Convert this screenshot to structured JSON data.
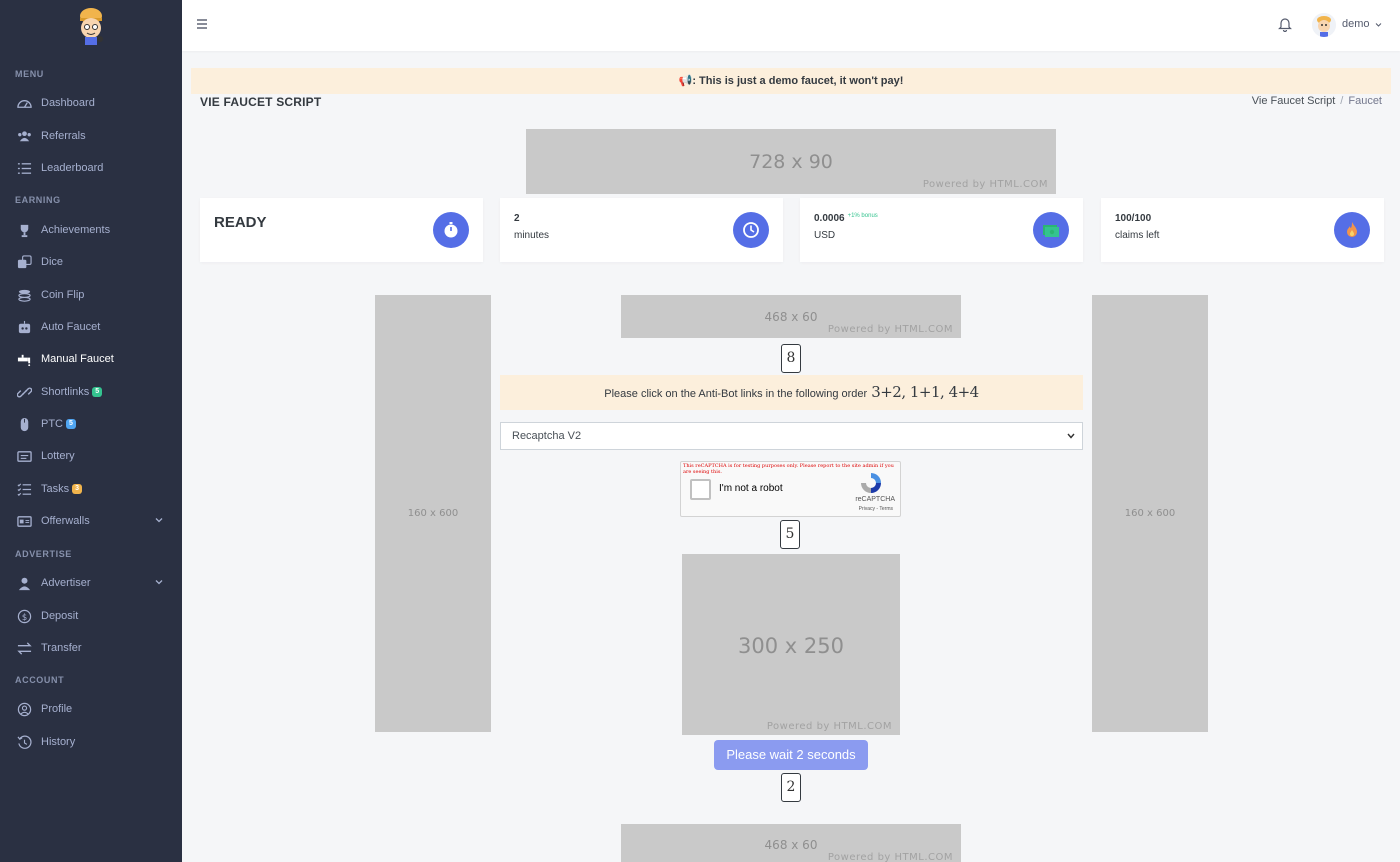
{
  "sidebar": {
    "sections": {
      "menu": "MENU",
      "earning": "EARNING",
      "advertise": "ADVERTISE",
      "account": "ACCOUNT"
    },
    "items": {
      "dashboard": "Dashboard",
      "referrals": "Referrals",
      "leaderboard": "Leaderboard",
      "achievements": "Achievements",
      "dice": "Dice",
      "coinflip": "Coin Flip",
      "autofaucet": "Auto Faucet",
      "manualfaucet": "Manual Faucet",
      "shortlinks": "Shortlinks",
      "ptc": "PTC",
      "lottery": "Lottery",
      "tasks": "Tasks",
      "offerwalls": "Offerwalls",
      "advertiser": "Advertiser",
      "deposit": "Deposit",
      "transfer": "Transfer",
      "profile": "Profile",
      "history": "History"
    },
    "badges": {
      "shortlinks": "5",
      "ptc": "5",
      "tasks": "3"
    },
    "active": "manualfaucet"
  },
  "header": {
    "user": "demo"
  },
  "notice": "📢: This is just a demo faucet, it won't pay!",
  "page": {
    "title": "VIE FAUCET SCRIPT",
    "breadcrumb": [
      "Vie Faucet Script",
      "Faucet"
    ]
  },
  "ads": {
    "banner_728": "728 x 90",
    "banner_468_top": "468 x 60",
    "sky_left": "160 x 600",
    "sky_right": "160 x 600",
    "rect_300": "300 x 250",
    "banner_468_bottom": "468 x 60",
    "powered": "Powered by HTML.COM"
  },
  "stats": {
    "status": "READY",
    "timer_value": "2",
    "timer_unit": "minutes",
    "reward_value": "0.0006",
    "reward_bonus": "+1% bonus",
    "reward_unit": "USD",
    "claims_value": "100/100",
    "claims_unit": "claims left"
  },
  "antibot": {
    "text": "Please click on the Anti-Bot links in the following order",
    "order": "3+2, 1+1, 4+4",
    "links": [
      "8",
      "5",
      "2"
    ]
  },
  "captcha": {
    "select_value": "Recaptcha V2",
    "warning": "This reCAPTCHA is for testing purposes only. Please report to the site admin if you are seeing this.",
    "checkbox_label": "I'm not a robot",
    "brand": "reCAPTCHA",
    "links": "Privacy - Terms"
  },
  "claim_button": "Please wait 2 seconds",
  "colors": {
    "sidebar_bg": "#2a3042",
    "accent": "#556ee6",
    "notice_bg": "#fcefdc",
    "ad_gray": "#c9c9c9"
  }
}
